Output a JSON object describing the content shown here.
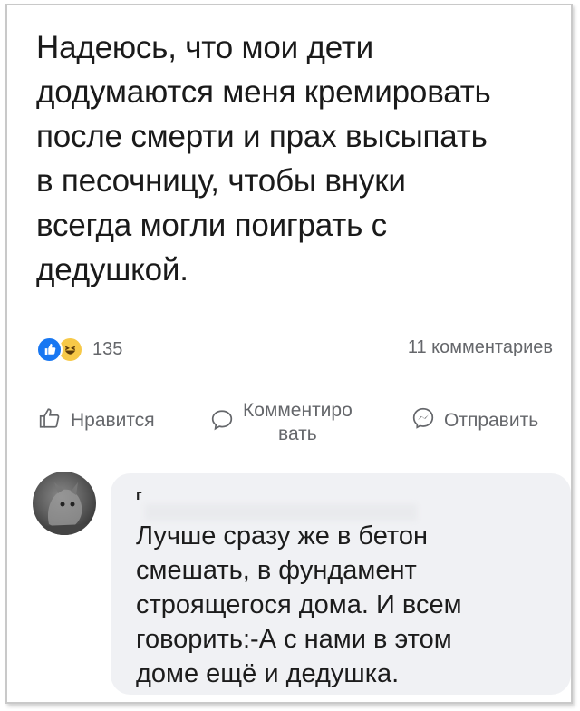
{
  "post": {
    "lines": [
      "Надеюсь, что мои дети",
      "додумаются меня кремировать",
      "после смерти и прах высыпать",
      "в песочницу, чтобы внуки",
      "всегда могли поиграть с",
      "дедушкой."
    ],
    "reaction_count": "135",
    "comments_count": "11 комментариев"
  },
  "actions": {
    "like_label": "Нравится",
    "comment_label_line1": "Комментиро",
    "comment_label_line2": "вать",
    "send_label": "Отправить"
  },
  "comment": {
    "author_prefix": "г",
    "lines": [
      "Лучше сразу же в бетон",
      "смешать, в фундамент",
      "строящегося дома. И всем",
      "говорить:-А с нами в этом",
      "доме ещё и дедушка."
    ]
  },
  "icons": {
    "like_reaction": "thumbs-up-icon",
    "haha_reaction": "haha-emoji-icon",
    "like_action": "thumbs-up-outline-icon",
    "comment_action": "speech-bubble-icon",
    "send_action": "messenger-icon"
  },
  "colors": {
    "like_blue": "#1877f2",
    "haha_yellow": "#f7c948",
    "secondary_text": "#65676b",
    "bubble_bg": "#f0f1f4"
  }
}
